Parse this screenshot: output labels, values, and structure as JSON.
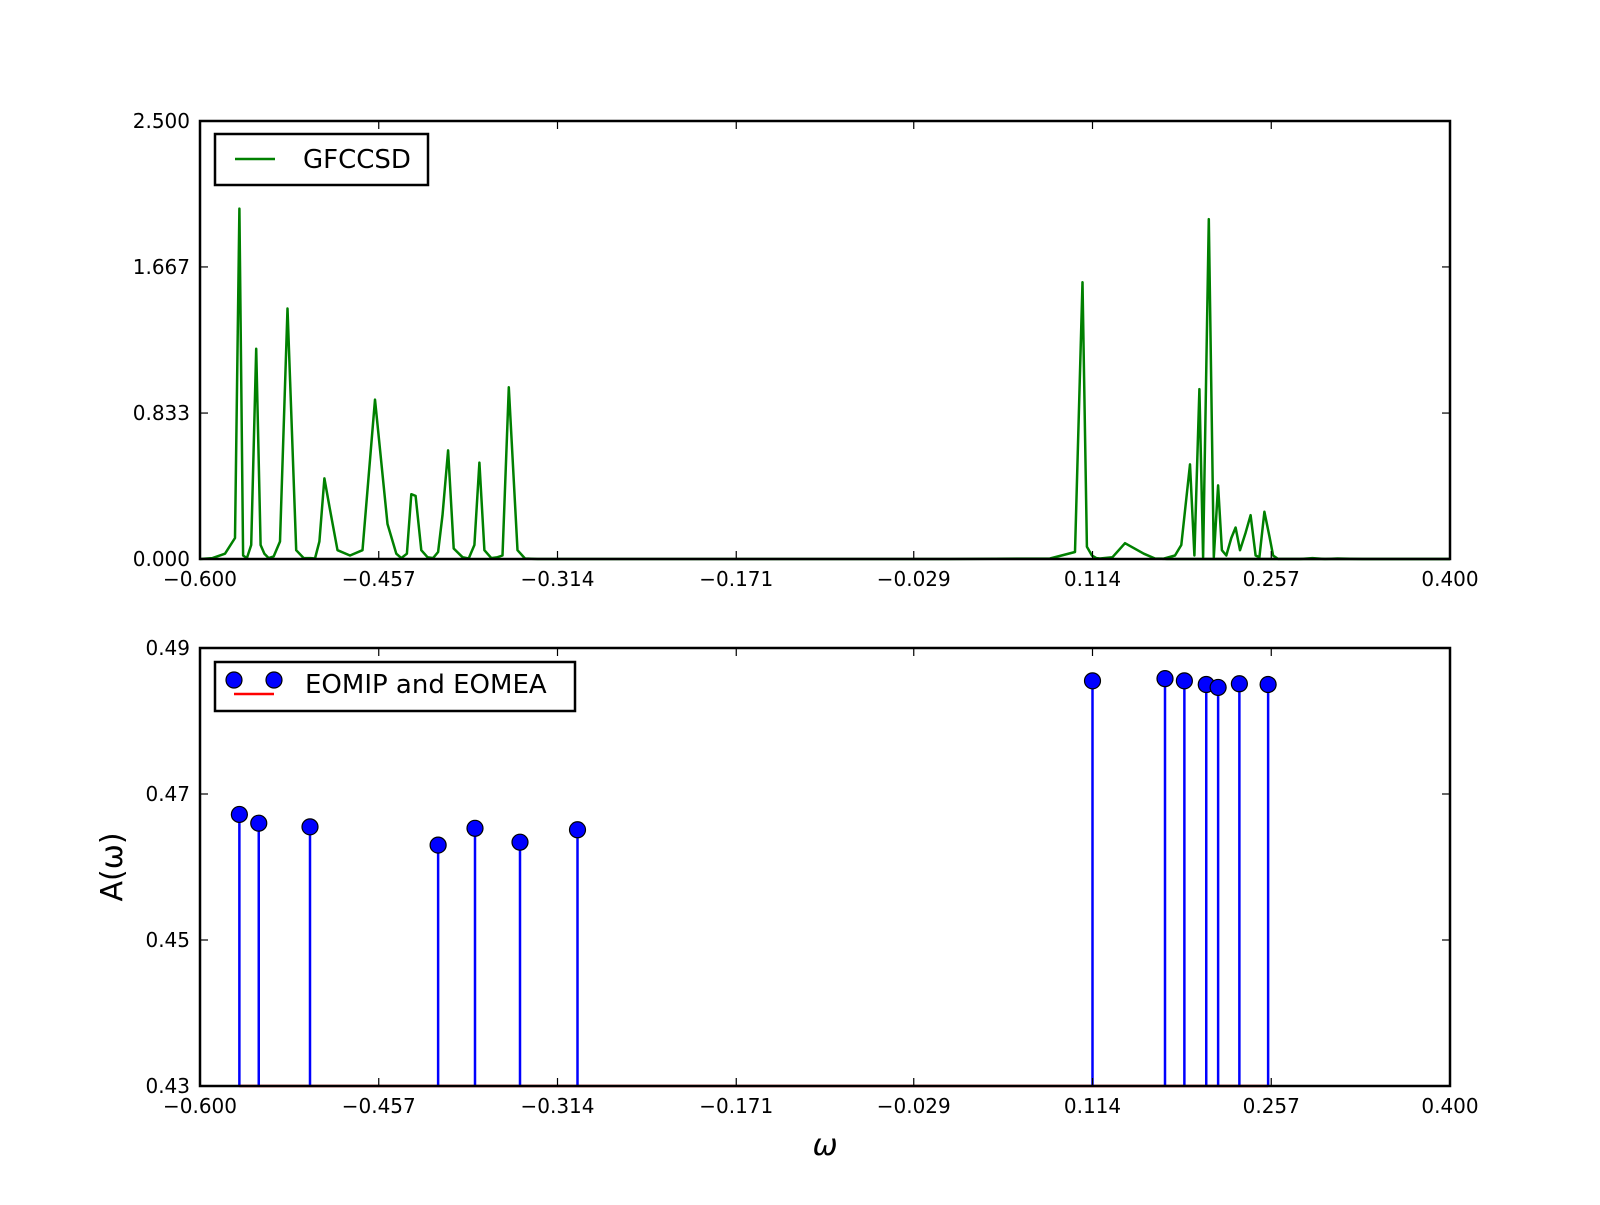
{
  "chart_data": [
    {
      "type": "line",
      "title": "",
      "xlabel": "",
      "ylabel": "",
      "xlim": [
        -0.6,
        0.4
      ],
      "ylim": [
        0,
        2.5
      ],
      "grid": false,
      "legend_position": "top-left",
      "xticks": [
        -0.6,
        -0.457,
        -0.314,
        -0.171,
        -0.029,
        0.114,
        0.257,
        0.4
      ],
      "xtick_labels": [
        "−0.600",
        "−0.457",
        "−0.314",
        "−0.171",
        "−0.029",
        "0.114",
        "0.257",
        "0.400"
      ],
      "yticks": [
        0,
        0.833,
        1.667,
        2.5
      ],
      "ytick_labels": [
        "0.000",
        "0.833",
        "1.667",
        "2.500"
      ],
      "series": [
        {
          "name": "GFCCSD",
          "color": "#008000",
          "x": [
            -0.6,
            -0.59,
            -0.58,
            -0.572,
            -0.5685,
            -0.5655,
            -0.5625,
            -0.559,
            -0.555,
            -0.5515,
            -0.5485,
            -0.545,
            -0.541,
            -0.536,
            -0.53,
            -0.523,
            -0.517,
            -0.5115,
            -0.508,
            -0.5045,
            -0.5005,
            -0.4965,
            -0.49,
            -0.48,
            -0.47,
            -0.46,
            -0.45,
            -0.443,
            -0.439,
            -0.4345,
            -0.431,
            -0.4275,
            -0.423,
            -0.418,
            -0.4135,
            -0.4095,
            -0.406,
            -0.4015,
            -0.397,
            -0.39,
            -0.385,
            -0.3805,
            -0.3765,
            -0.3725,
            -0.367,
            -0.362,
            -0.358,
            -0.353,
            -0.346,
            -0.34,
            -0.33,
            -0.32,
            -0.3,
            -0.2,
            -0.1,
            0.0,
            0.08,
            0.1,
            0.106,
            0.1095,
            0.1135,
            0.117,
            0.12,
            0.13,
            0.14,
            0.155,
            0.164,
            0.1695,
            0.1735,
            0.178,
            0.1825,
            0.1865,
            0.1905,
            0.194,
            0.198,
            0.2025,
            0.2065,
            0.2105,
            0.2135,
            0.217,
            0.22,
            0.225,
            0.23,
            0.235,
            0.238,
            0.242,
            0.245,
            0.25,
            0.255,
            0.2625,
            0.267,
            0.27,
            0.28,
            0.3,
            0.32,
            0.4
          ],
          "y": [
            0,
            0.005,
            0.03,
            0.12,
            2.0,
            0.02,
            0.005,
            0.08,
            1.2,
            0.08,
            0.03,
            0.005,
            0.015,
            0.1,
            1.43,
            0.05,
            0.005,
            0.005,
            0.003,
            0.1,
            0.46,
            0.3,
            0.05,
            0.02,
            0.05,
            0.91,
            0.2,
            0.03,
            0.005,
            0.03,
            0.37,
            0.36,
            0.05,
            0.01,
            0.005,
            0.04,
            0.25,
            0.62,
            0.06,
            0.01,
            0.003,
            0.08,
            0.55,
            0.05,
            0.005,
            0.01,
            0.02,
            0.98,
            0.05,
            0.003,
            0.0,
            0.0,
            0.0,
            0.0,
            0.0,
            0.0,
            0.003,
            0.04,
            1.58,
            0.07,
            0.02,
            0.005,
            0.003,
            0.01,
            0.09,
            0.03,
            0.003,
            0.002,
            0.0,
            0.0,
            0.0,
            0.0,
            0.0,
            0.0,
            0.0,
            0.0,
            0.0,
            0.0,
            0.0,
            0.0,
            0.0,
            0.0,
            0.0,
            0.0,
            0.0,
            0.0,
            0.0,
            0.0,
            0.0,
            0.0,
            0.0,
            0.0,
            0.0,
            0.0,
            0.0,
            0.0
          ],
          "x2": [
            0.17,
            0.18,
            0.185,
            0.192,
            0.1955,
            0.1995,
            0.2025,
            0.207,
            0.211,
            0.2145,
            0.2175,
            0.221,
            0.225,
            0.2285,
            0.232,
            0.2365,
            0.2405,
            0.2445,
            0.2475,
            0.2515,
            0.2555,
            0.2585,
            0.2625,
            0.2665,
            0.2705,
            0.274,
            0.28,
            0.29,
            0.3,
            0.31,
            0.33,
            0.35,
            0.4
          ],
          "y2": [
            0.0,
            0.02,
            0.08,
            0.54,
            0.02,
            0.97,
            0.01,
            1.94,
            0.01,
            0.42,
            0.05,
            0.02,
            0.12,
            0.18,
            0.05,
            0.15,
            0.25,
            0.02,
            0.01,
            0.27,
            0.13,
            0.02,
            0.0,
            0.0,
            0.0,
            0.0,
            0.0,
            0.005,
            0.0,
            0.003,
            0.0,
            0.0,
            0.0
          ]
        }
      ]
    },
    {
      "type": "stem",
      "title": "",
      "xlabel": "ω",
      "ylabel": "A(ω)",
      "xlim": [
        -0.6,
        0.4
      ],
      "ylim": [
        0.43,
        0.49
      ],
      "grid": false,
      "legend_position": "top-left",
      "xticks": [
        -0.6,
        -0.457,
        -0.314,
        -0.171,
        -0.029,
        0.114,
        0.257,
        0.4
      ],
      "xtick_labels": [
        "−0.600",
        "−0.457",
        "−0.314",
        "−0.171",
        "−0.029",
        "0.114",
        "0.257",
        "0.400"
      ],
      "yticks": [
        0.43,
        0.45,
        0.47,
        0.49
      ],
      "ytick_labels": [
        "0.43",
        "0.45",
        "0.47",
        "0.49"
      ],
      "series": [
        {
          "name": "EOMIP and EOMEA",
          "marker_color": "#0000ff",
          "stem_color": "#0000ff",
          "baseline_color": "#ff0000",
          "x": [
            -0.5685,
            -0.553,
            -0.512,
            -0.4095,
            -0.38,
            -0.344,
            -0.298,
            0.114,
            0.172,
            0.1875,
            0.205,
            0.2145,
            0.2315,
            0.2545
          ],
          "y": [
            0.4672,
            0.466,
            0.4655,
            0.463,
            0.4653,
            0.4634,
            0.4651,
            0.4855,
            0.4858,
            0.4855,
            0.485,
            0.4846,
            0.4851,
            0.485
          ]
        }
      ]
    }
  ]
}
